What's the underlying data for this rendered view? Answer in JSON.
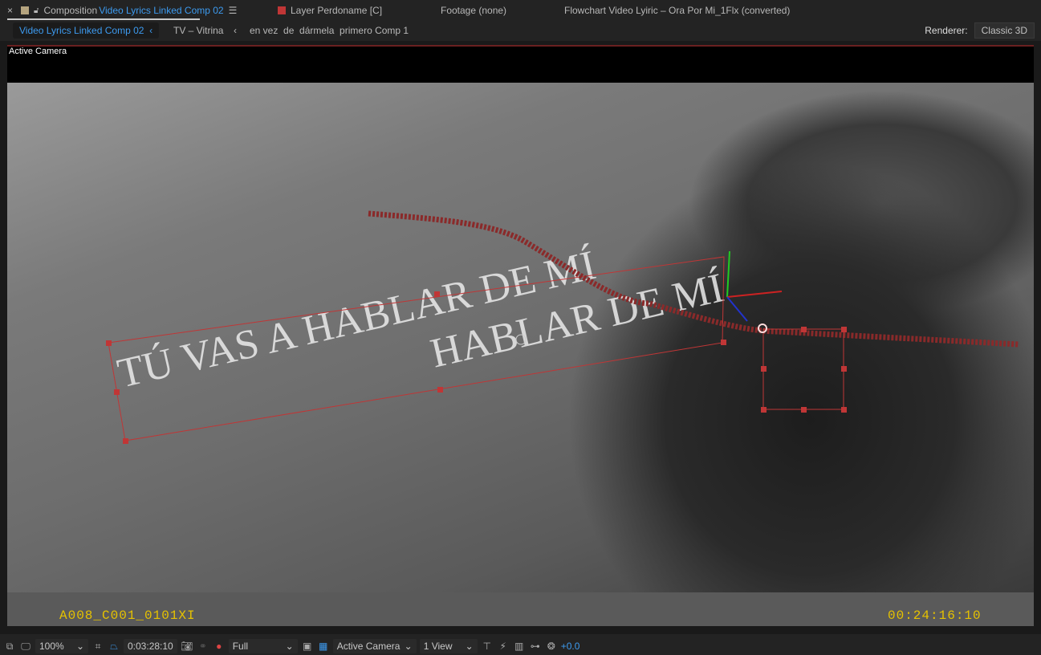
{
  "tabs": {
    "composition": {
      "prefix": "Composition",
      "name": "Video Lyrics Linked Comp 02",
      "swatch": "#b5a47f"
    },
    "layer": {
      "label": "Layer Perdoname [C]",
      "swatch": "#c03636"
    },
    "footage": {
      "label": "Footage (none)"
    },
    "flowchart": {
      "label": "Flowchart Video Lyiric – Ora Por Mi_1Flx (converted)"
    }
  },
  "breadcrumbs": [
    "Video Lyrics Linked Comp 02",
    "TV – Vitrina",
    "en vez  de  dármela  primero Comp 1"
  ],
  "renderer": {
    "label": "Renderer:",
    "value": "Classic 3D"
  },
  "viewer": {
    "camera_label": "Active Camera",
    "clip_name": "A008_C001_0101XI",
    "timecode": "00:24:16:10",
    "lyric_line1": "TÚ VAS A HABLAR DE MÍ",
    "lyric_line2": "HABLAR DE MÍ"
  },
  "toolbar": {
    "zoom": "100%",
    "current_time": "0:03:28:10",
    "resolution": "Full",
    "view": "Active Camera",
    "layout": "1 View",
    "exposure": "+0.0"
  },
  "colors": {
    "accent": "#3d9bf0",
    "path": "#c03636",
    "timecode": "#e6c200"
  }
}
